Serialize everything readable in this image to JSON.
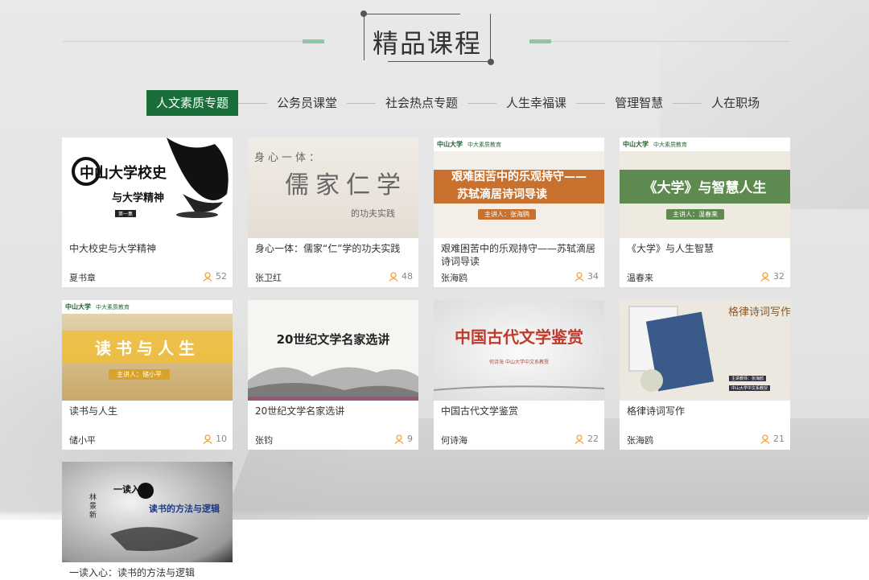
{
  "section_title": "精品课程",
  "tabs": [
    {
      "label": "人文素质专题",
      "active": true
    },
    {
      "label": "公务员课堂",
      "active": false
    },
    {
      "label": "社会热点专题",
      "active": false
    },
    {
      "label": "人生幸福课",
      "active": false
    },
    {
      "label": "管理智慧",
      "active": false
    },
    {
      "label": "人在职场",
      "active": false
    }
  ],
  "colors": {
    "accent": "#1a6e3a",
    "light_accent": "#8ec5a4",
    "count": "#f0a040"
  },
  "cards": [
    {
      "title": "中大校史与大学精神",
      "teacher": "夏书章",
      "count": "52",
      "thumb": {
        "l1": "中山大学校史",
        "l2": "与大学精神",
        "l3": "第一集"
      }
    },
    {
      "title": "身心一体：儒家“仁”学的功夫实践",
      "teacher": "张卫红",
      "count": "48",
      "thumb": {
        "l1": "身心一体：",
        "l2": "儒家仁学",
        "l3": "的功夫实践"
      }
    },
    {
      "title": "艰难困苦中的乐观持守——苏轼滴居诗词导读",
      "teacher": "张海鸥",
      "count": "34",
      "thumb": {
        "logo": "中山大学",
        "logo2": "中大素质教育",
        "l1": "艰难困苦中的乐观持守——",
        "l2": "苏轼滴居诗词导读",
        "l3": "主讲人：张海鸥"
      }
    },
    {
      "title": "《大学》与人生智慧",
      "teacher": "温春来",
      "count": "32",
      "thumb": {
        "logo": "中山大学",
        "logo2": "中大素质教育",
        "l1": "《大学》与智慧人生",
        "l3": "主讲人：温春来"
      }
    },
    {
      "title": "读书与人生",
      "teacher": "储小平",
      "count": "10",
      "thumb": {
        "logo": "中山大学",
        "logo2": "中大素质教育",
        "l1": "读书与人生",
        "l3": "主讲人：储小平"
      }
    },
    {
      "title": "20世纪文学名家选讲",
      "teacher": "张钧",
      "count": "9",
      "thumb": {
        "l1": "20世纪文学名家选讲"
      }
    },
    {
      "title": "中国古代文学鉴赏",
      "teacher": "何诗海",
      "count": "22",
      "thumb": {
        "l1": "中国古代文学鉴赏",
        "l2": "何诗海 中山大学中文系教授"
      }
    },
    {
      "title": "格律诗词写作",
      "teacher": "张海鸥",
      "count": "21",
      "thumb": {
        "l1": "格律诗词写作",
        "l2": "主讲教师：张海鸥",
        "l3": "中山大学中文系教授"
      }
    },
    {
      "title": "一读入心：读书的方法与逻辑",
      "teacher": "",
      "count": "",
      "thumb": {
        "l1": "一读入心",
        "l2": "读书的方法与逻辑",
        "l3": "林景新"
      }
    }
  ]
}
